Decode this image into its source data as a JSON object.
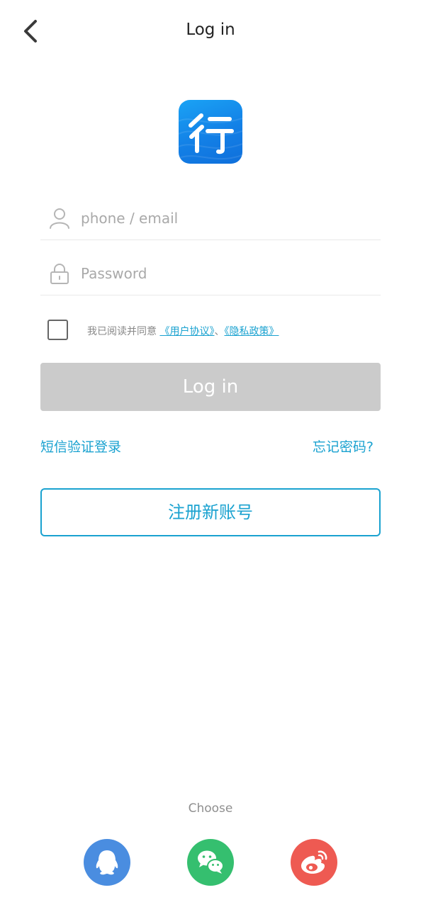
{
  "header": {
    "title": "Log in",
    "back_icon": "chevron-left-icon"
  },
  "logo": {
    "glyph": "行",
    "colors": {
      "top": "#1aa3f5",
      "bottom": "#0f6fdb"
    }
  },
  "form": {
    "phone": {
      "placeholder": "phone / email",
      "value": "",
      "icon": "user-icon"
    },
    "password": {
      "placeholder": "Password",
      "value": "",
      "icon": "lock-icon"
    },
    "agreement": {
      "checked": false,
      "prefix": "我已阅读并同意",
      "user_agreement": "《用户协议》",
      "separator": "、",
      "privacy_policy": "《隐私政策》"
    },
    "login_label": "Log in"
  },
  "links": {
    "sms_login": "短信验证登录",
    "forgot_password": "忘记密码?"
  },
  "register_label": "注册新账号",
  "third_party": {
    "label": "Choose",
    "providers": [
      {
        "name": "qq",
        "icon": "qq-icon",
        "color": "#4a8de0"
      },
      {
        "name": "wechat",
        "icon": "wechat-icon",
        "color": "#35bf6f"
      },
      {
        "name": "weibo",
        "icon": "weibo-icon",
        "color": "#ee5a52"
      }
    ]
  },
  "colors": {
    "accent": "#1aa2d0",
    "disabled_button": "#cbcbcb",
    "placeholder": "#a9a9a9"
  }
}
